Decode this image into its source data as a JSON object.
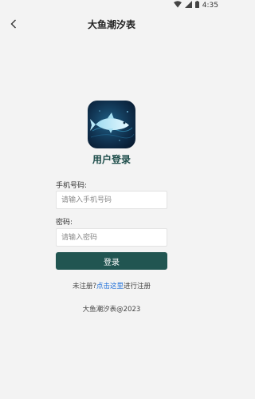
{
  "status_bar": {
    "time": "4:35"
  },
  "nav": {
    "title": "大鱼潮汐表"
  },
  "login": {
    "heading": "用户登录",
    "phone_label": "手机号码:",
    "phone_placeholder": "请输入手机号码",
    "phone_value": "",
    "password_label": "密码:",
    "password_placeholder": "请输入密码",
    "password_value": "",
    "submit_label": "登录"
  },
  "register": {
    "prompt": "未注册?",
    "link": "点击这里",
    "suffix": "进行注册"
  },
  "footer": {
    "copyright": "大鱼潮汐表@2023"
  },
  "colors": {
    "accent": "#215551",
    "heading": "#1d4d4a",
    "link": "#1e6fd9",
    "background": "#f3f3f3"
  },
  "icons": [
    "back-arrow-icon",
    "wifi-icon",
    "cellular-signal-icon",
    "battery-icon",
    "fish-logo-icon"
  ]
}
